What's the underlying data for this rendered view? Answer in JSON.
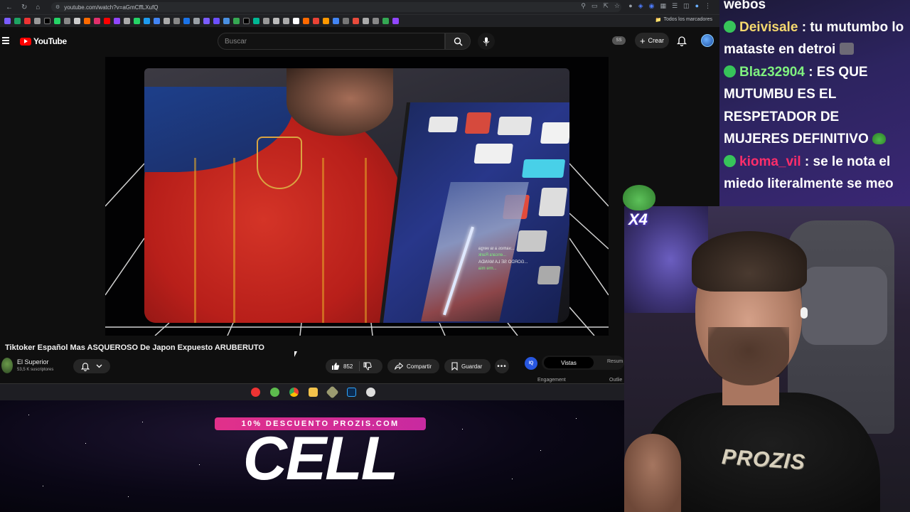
{
  "browser": {
    "url": "youtube.com/watch?v=aGmCffLXufQ",
    "bookmarks_folder": "Todos los marcadores"
  },
  "youtube": {
    "logo_text": "YouTube",
    "search_placeholder": "Buscar",
    "ss_label": "SS",
    "create_label": "Crear"
  },
  "video": {
    "title": "Tiktoker Español Mas ASQUEROSO De Japon Expuesto ARUBERUTO",
    "channel_name": "El Superior",
    "subscribers": "53,5 K suscriptores",
    "like_count": "852",
    "share_label": "Compartir",
    "save_label": "Guardar",
    "overlay_chat": [
      "...vamos a la verga",
      "...encara Rank",
      "...GORDO SE LA MANDA",
      "...rrre mia"
    ]
  },
  "vidiq": {
    "badge": "IQ",
    "tab_active": "Vistas",
    "tab_other": "Resum",
    "sub_left": "Engagement",
    "sub_right": "Outlie"
  },
  "promo": {
    "banner": "10% DESCUENTO PROZIS.COM",
    "big_word": "CELL"
  },
  "chat": {
    "top_fragment": "webos",
    "messages": [
      {
        "user": "Deivisale",
        "text": ": tu mutumbo lo mataste en detroi"
      },
      {
        "user": "Blaz32904",
        "text": ": ES QUE MUTUMBU ES EL RESPETADOR DE MUJERES DEFINITIVO"
      },
      {
        "user": "kioma_vil",
        "text": ": se le nota el miedo literalmente se meo"
      }
    ]
  },
  "webcam": {
    "emote_count": "X4",
    "shirt_text": "PROZIS"
  },
  "colors": {
    "youtube_red": "#ff0000",
    "chat_user_1": "#f5d86e",
    "chat_user_2": "#7ff07f",
    "chat_user_3": "#ff2d6a",
    "promo_pink": "#e1308a",
    "vidiq_blue": "#2857e0"
  }
}
